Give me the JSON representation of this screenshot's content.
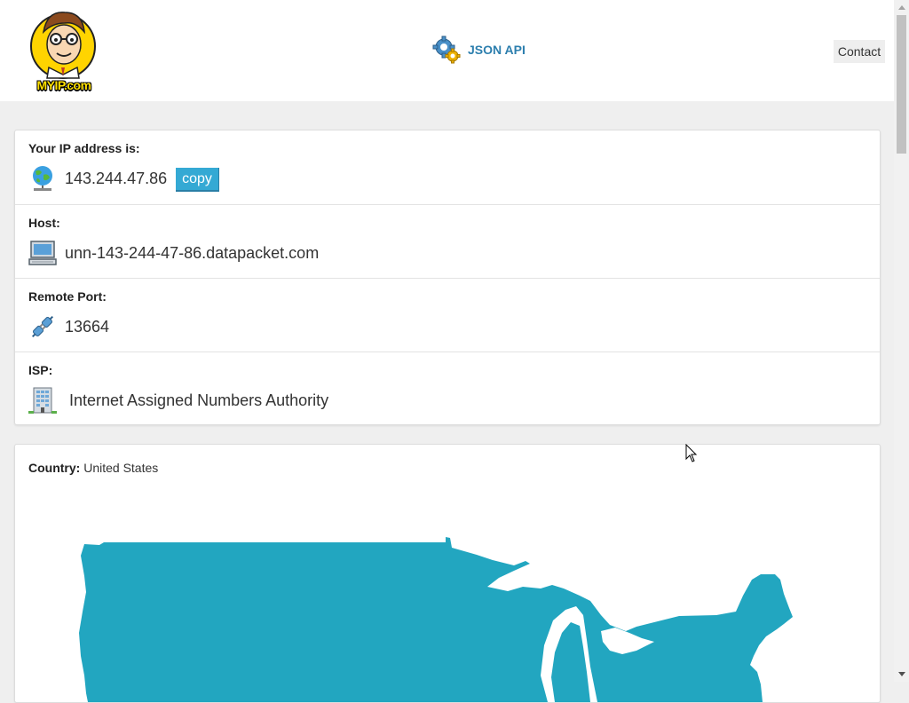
{
  "header": {
    "logo_text": "MYIP.com",
    "api_label": "JSON API",
    "contact_label": "Contact"
  },
  "info": {
    "ip": {
      "label": "Your IP address is:",
      "value": "143.244.47.86",
      "copy_label": "copy",
      "icon": "globe-network-icon"
    },
    "host": {
      "label": "Host:",
      "value": "unn-143-244-47-86.datapacket.com",
      "icon": "computer-icon"
    },
    "port": {
      "label": "Remote Port:",
      "value": "13664",
      "icon": "plug-icon"
    },
    "isp": {
      "label": "ISP:",
      "value": "Internet Assigned Numbers Authority",
      "icon": "building-icon"
    }
  },
  "location": {
    "country_label": "Country:",
    "country": "United States",
    "map_color": "#22a6c0"
  },
  "colors": {
    "accent": "#34a9d4",
    "api_link": "#2d7fae",
    "map": "#22a6c0"
  }
}
